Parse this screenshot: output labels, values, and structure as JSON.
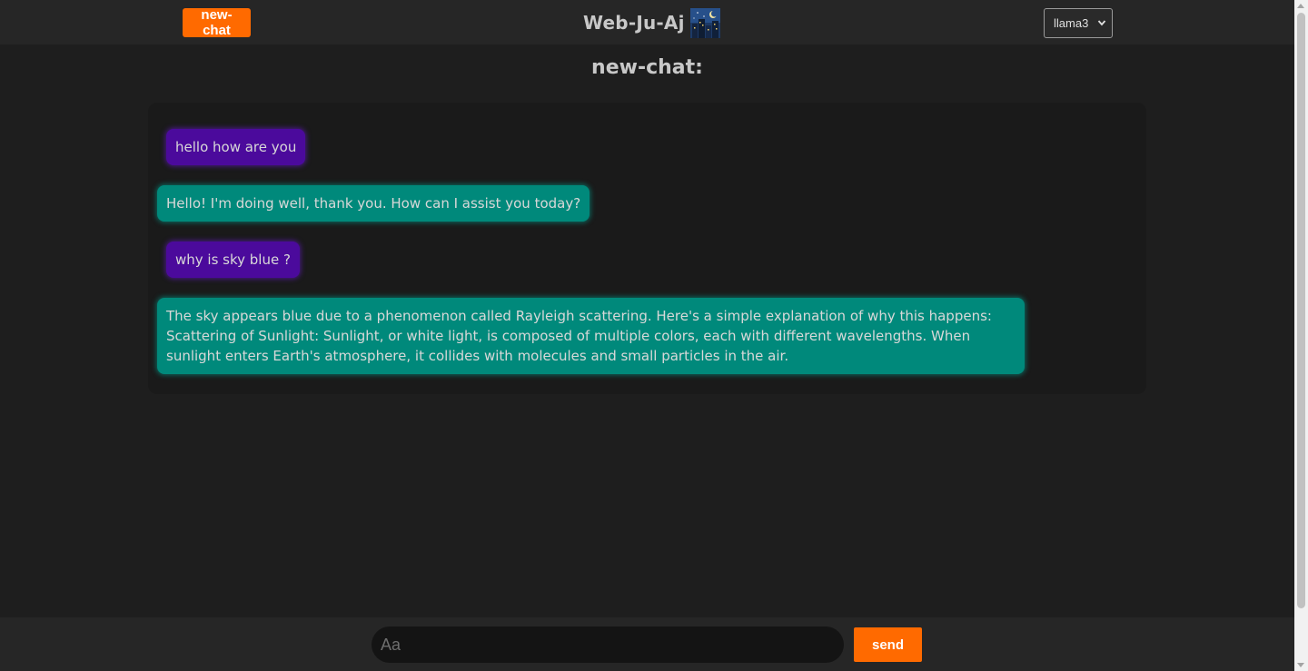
{
  "header": {
    "new_chat_label": "new-chat",
    "brand_title": "Web-Ju-Aj",
    "brand_logo_icon": "night-city-icon",
    "model_select": {
      "selected": "llama3"
    }
  },
  "chat": {
    "heading": "new-chat:",
    "messages": [
      {
        "role": "user",
        "text": "hello how are you"
      },
      {
        "role": "assistant",
        "text": "Hello! I'm doing well, thank you. How can I assist you today?"
      },
      {
        "role": "user",
        "text": "why is sky blue ?"
      },
      {
        "role": "assistant",
        "text": "The sky appears blue due to a phenomenon called Rayleigh scattering. Here's a simple explanation of why this happens: Scattering of Sunlight: Sunlight, or white light, is composed of multiple colors, each with different wavelengths. When sunlight enters Earth's atmosphere, it collides with molecules and small particles in the air."
      }
    ]
  },
  "composer": {
    "placeholder": "Aa",
    "value": "",
    "send_label": "send"
  },
  "colors": {
    "accent": "#ff6a00",
    "user_bubble": "#4b0a9c",
    "assistant_bubble": "#00897b",
    "background": "#1e1e1e"
  }
}
